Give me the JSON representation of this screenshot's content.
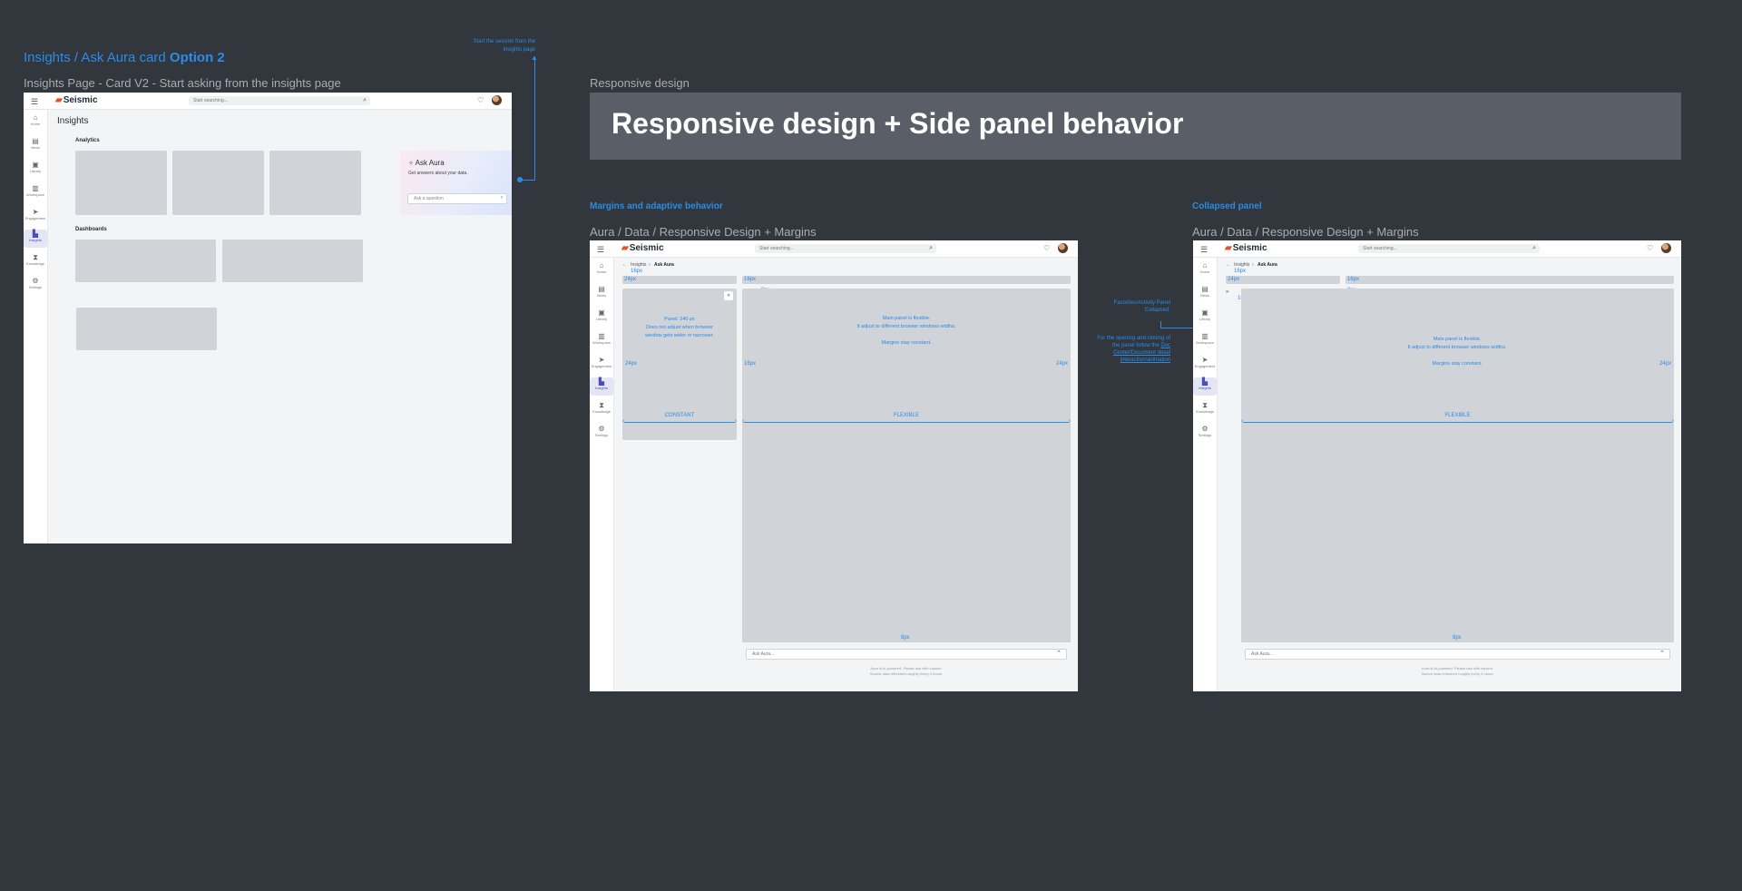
{
  "option_section": {
    "title_prefix": "Insights / Ask Aura card ",
    "title_emphasis": "Option 2",
    "subtitle": "Insights Page - Card V2 - Start asking from the insights page",
    "annotation": "Start the session from the insights page"
  },
  "app": {
    "logo": "Seismic",
    "search_placeholder": "Start searching...",
    "nav": [
      {
        "icon": "home-icon",
        "label": "Home"
      },
      {
        "icon": "news-icon",
        "label": "News"
      },
      {
        "icon": "library-icon",
        "label": "Library"
      },
      {
        "icon": "workspace-icon",
        "label": "Workspace"
      },
      {
        "icon": "engagement-icon",
        "label": "Engagement"
      },
      {
        "icon": "insights-icon",
        "label": "Insights"
      },
      {
        "icon": "knowledge-icon",
        "label": "Knowledge"
      },
      {
        "icon": "settings-icon",
        "label": "Settings"
      }
    ]
  },
  "insights_page": {
    "title": "Insights",
    "analytics_label": "Analytics",
    "dashboards_label": "Dashboards",
    "ask_card": {
      "title": "Ask Aura",
      "subtitle": "Get answers about your data.",
      "input_placeholder": "Ask a question"
    }
  },
  "responsive": {
    "small_label": "Responsive design",
    "banner": "Responsive design + Side panel behavior"
  },
  "margins_section": {
    "heading": "Margins and adaptive behavior",
    "frame_title": "Aura / Data / Responsive Design + Margins",
    "breadcrumb_parent": "Insights",
    "breadcrumb_current": "Ask Aura",
    "panel_text": "Panel: 240 px\nDoes not adjust when browser window gets wider or narrower.",
    "main_text": "Main panel is flexible.\nIt adjust to different browser windows widths.\n\nMargins stay constant.",
    "constant": "CONSTANT",
    "flexible": "FLEXIBLE",
    "m16": "16px",
    "m24": "24px",
    "m8": "8px",
    "ask_placeholder": "Ask Aura...",
    "footer_1": "Aura is AI-powered. Please use with caution.",
    "footer_2": "Source data refreshed roughly every 4 hours."
  },
  "collapsed_section": {
    "heading": "Collapsed panel",
    "frame_title": "Aura / Data / Responsive Design + Margins",
    "note_1": "Favorites/Activity Panel Collapsed.",
    "note_2_prefix": "For the opening and closing of the panel follow the ",
    "note_2_link": "Doc Center/Document detail interaction/animation",
    "main_text": "Main panel is flexible.\nIt adjust to different browser windows widths.\n\nMargins stay constant."
  }
}
